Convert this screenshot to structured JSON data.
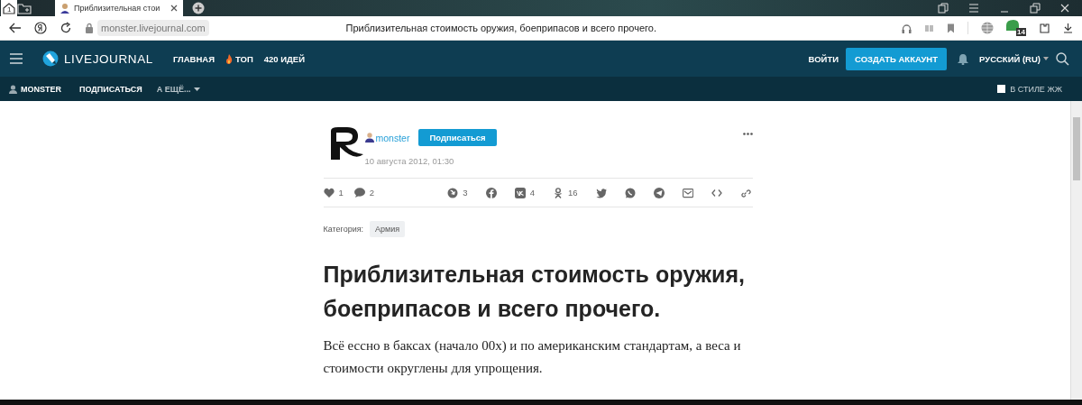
{
  "browser": {
    "tab_count": "1",
    "tab": {
      "title": "Приблизительная стои",
      "selected": true
    },
    "url": "monster.livejournal.com",
    "page_title": "Приблизительная стоимость оружия, боеприпасов и всего прочего.",
    "extension_badge": "14"
  },
  "header": {
    "logo": "LIVEJOURNAL",
    "nav": [
      {
        "label": "ГЛАВНАЯ",
        "kind": "plain"
      },
      {
        "label": "ТОП",
        "kind": "fire"
      },
      {
        "label": "420 ИДЕЙ",
        "kind": "plain"
      }
    ],
    "login": "ВОЙТИ",
    "signup": "СОЗДАТЬ АККАУНТ",
    "language": "РУССКИЙ (RU)"
  },
  "subbar": {
    "user": "MONSTER",
    "subscribe": "ПОДПИСАТЬСЯ",
    "more": "А ЕЩЁ...",
    "style_toggle": {
      "label": "В СТИЛЕ ЖЖ",
      "checked": false
    }
  },
  "post": {
    "author": "monster",
    "subscribe": "Подписаться",
    "date": "10 августа 2012, 01:30",
    "likes": "1",
    "comments": "2",
    "shares": [
      {
        "kind": "repost",
        "count": "3"
      },
      {
        "kind": "facebook"
      },
      {
        "kind": "vk",
        "count": "4"
      },
      {
        "kind": "ok",
        "count": "16"
      },
      {
        "kind": "twitter"
      },
      {
        "kind": "whatsapp"
      },
      {
        "kind": "telegram"
      },
      {
        "kind": "mail"
      },
      {
        "kind": "embed"
      },
      {
        "kind": "link"
      }
    ],
    "category_label": "Категория:",
    "category": "Армия",
    "title": "Приблизительная стоимость оружия, боеприпасов и всего прочего.",
    "lead": "Всё ессно в баксах (начало 00х) и по американским стандартам, а веса и стоимости округлены для упрощения."
  }
}
